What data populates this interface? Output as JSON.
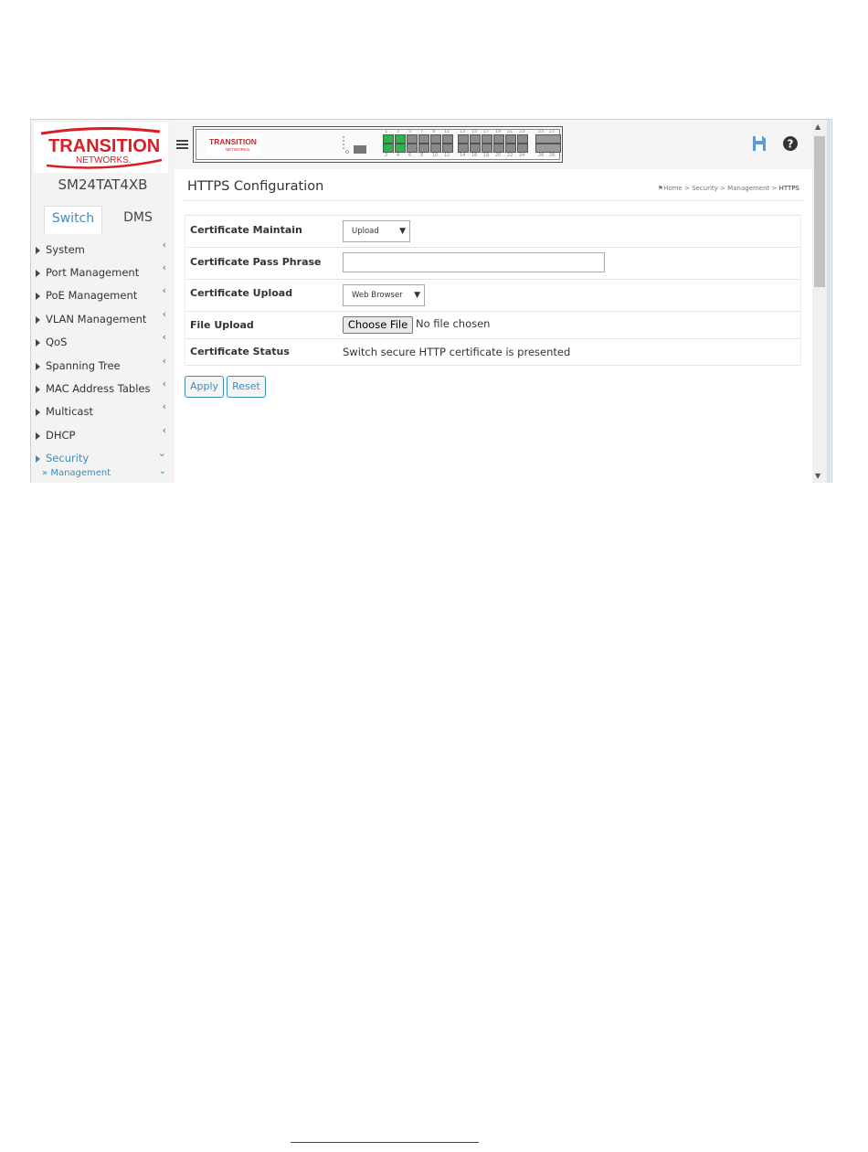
{
  "device": {
    "name": "SM24TAT4XB",
    "brand": "TRANSITION",
    "brand_sub": "NETWORKS."
  },
  "tabs": [
    {
      "label": "Switch"
    },
    {
      "label": "DMS"
    }
  ],
  "sidebar": {
    "items": [
      {
        "label": "System"
      },
      {
        "label": "Port Management"
      },
      {
        "label": "PoE Management"
      },
      {
        "label": "VLAN Management"
      },
      {
        "label": "QoS"
      },
      {
        "label": "Spanning Tree"
      },
      {
        "label": "MAC Address Tables"
      },
      {
        "label": "Multicast"
      },
      {
        "label": "DHCP"
      },
      {
        "label": "Security"
      }
    ],
    "sub_item": {
      "label": "Management"
    },
    "chevron_collapsed": "‹",
    "chevron_expanded": "⌄"
  },
  "toolbar": {
    "icons": [
      "save-icon",
      "help-icon",
      "logout-icon"
    ],
    "accent": "#3c8dbc"
  },
  "page": {
    "title": "HTTPS Configuration"
  },
  "breadcrumb": {
    "home": "Home",
    "sep": ">",
    "items": [
      "Security",
      "Management"
    ],
    "current": "HTTPS"
  },
  "form": {
    "certificate_maintain": {
      "label": "Certificate Maintain",
      "value": "Upload"
    },
    "certificate_pass_phrase": {
      "label": "Certificate Pass Phrase",
      "value": ""
    },
    "certificate_upload": {
      "label": "Certificate Upload",
      "value": "Web Browser"
    },
    "file_upload": {
      "label": "File Upload",
      "button": "Choose File",
      "status": "No file chosen"
    },
    "certificate_status": {
      "label": "Certificate Status",
      "value": "Switch secure HTTP certificate is presented"
    }
  },
  "buttons": {
    "apply": "Apply",
    "reset": "Reset"
  },
  "port_panel": {
    "port_numbers_top": [
      "1",
      "3",
      "5",
      "7",
      "9",
      "11",
      "13",
      "15",
      "17",
      "19",
      "21",
      "23"
    ],
    "port_numbers_bottom": [
      "2",
      "4",
      "6",
      "8",
      "10",
      "12",
      "14",
      "16",
      "18",
      "20",
      "22",
      "24"
    ],
    "sfp_top": [
      "25",
      "27"
    ],
    "sfp_bottom": [
      "26",
      "28"
    ]
  }
}
